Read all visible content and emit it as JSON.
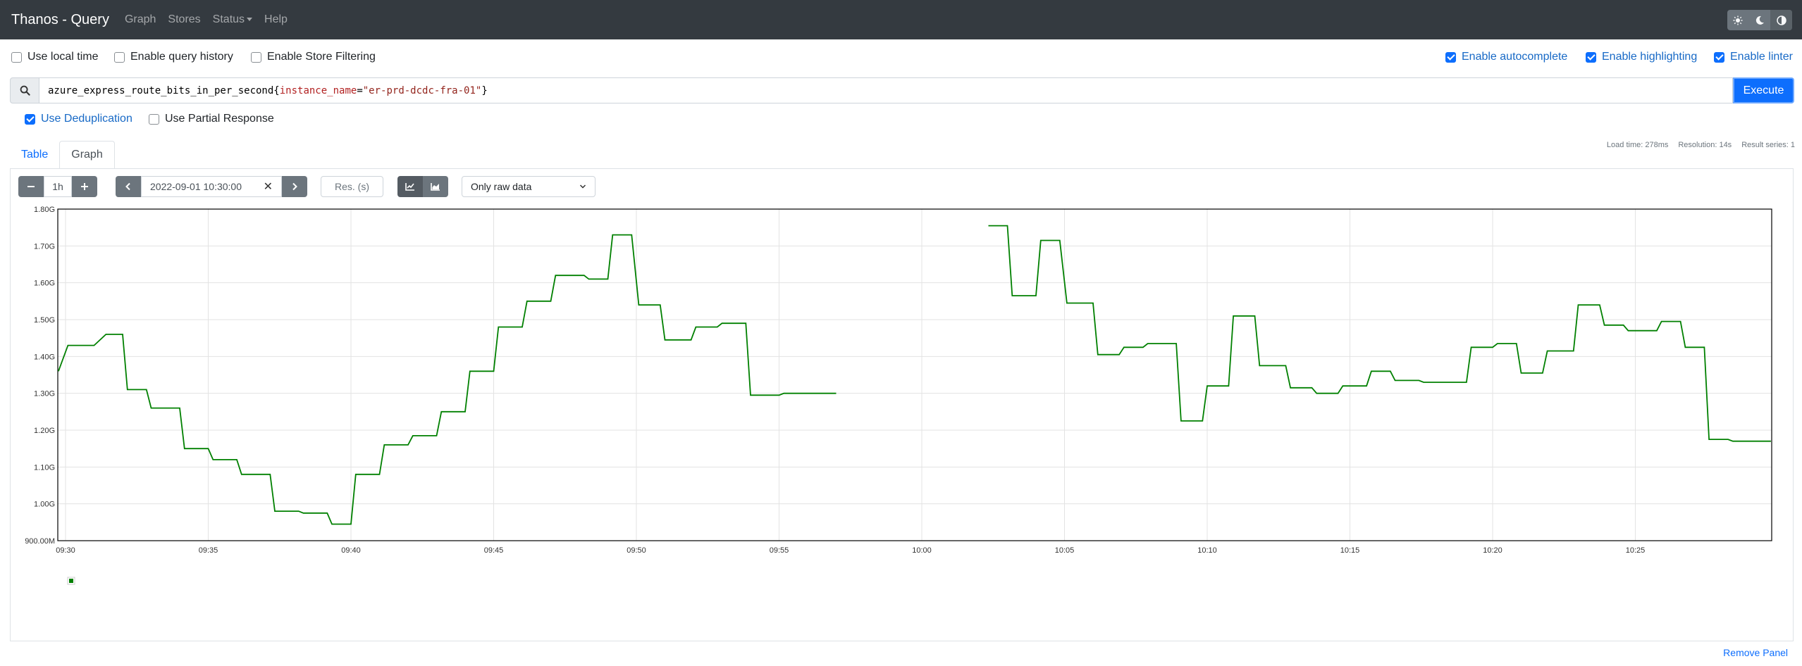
{
  "navbar": {
    "brand": "Thanos - Query",
    "links": [
      "Graph",
      "Stores",
      "Status",
      "Help"
    ],
    "theme_icons": [
      "sun-icon",
      "moon-icon",
      "contrast-icon"
    ]
  },
  "options_left": [
    {
      "label": "Use local time",
      "checked": false
    },
    {
      "label": "Enable query history",
      "checked": false
    },
    {
      "label": "Enable Store Filtering",
      "checked": false
    }
  ],
  "options_right": [
    {
      "label": "Enable autocomplete",
      "checked": true
    },
    {
      "label": "Enable highlighting",
      "checked": true
    },
    {
      "label": "Enable linter",
      "checked": true
    }
  ],
  "expression": {
    "metric": "azure_express_route_bits_in_per_second",
    "open_brace": "{",
    "label_name": "instance_name",
    "operator": "=",
    "label_value": "\"er-prd-dcdc-fra-01\"",
    "close_brace": "}"
  },
  "execute_label": "Execute",
  "query_options": [
    {
      "label": "Use Deduplication",
      "checked": true
    },
    {
      "label": "Use Partial Response",
      "checked": false
    }
  ],
  "tabs": [
    {
      "label": "Table",
      "active": false
    },
    {
      "label": "Graph",
      "active": true
    }
  ],
  "stats": {
    "load_time": "Load time: 278ms",
    "resolution": "Resolution: 14s",
    "result_series": "Result series: 1"
  },
  "graph_controls": {
    "range": "1h",
    "end_time": "2022-09-01 10:30:00",
    "res_placeholder": "Res. (s)",
    "downsampling": "Only raw data"
  },
  "colors": {
    "series": "#008000",
    "navbar": "#343a40",
    "primary": "#0d6efd"
  },
  "chart_data": {
    "type": "line",
    "x_unit": "time",
    "ylim": [
      900000000,
      1800000000
    ],
    "y_ticks": [
      "900.00M",
      "1.00G",
      "1.10G",
      "1.20G",
      "1.30G",
      "1.40G",
      "1.50G",
      "1.60G",
      "1.70G",
      "1.80G"
    ],
    "x_ticks": [
      "09:30",
      "09:35",
      "09:40",
      "09:45",
      "09:50",
      "09:55",
      "10:00",
      "10:05",
      "10:10",
      "10:15",
      "10:20",
      "10:25"
    ],
    "grid": true,
    "series": [
      {
        "segments": [
          [
            [
              "09:29:45",
              1.36
            ],
            [
              "09:30:05",
              1.43
            ],
            [
              "09:31:00",
              1.43
            ],
            [
              "09:31:25",
              1.46
            ],
            [
              "09:32:00",
              1.46
            ],
            [
              "09:32:10",
              1.31
            ],
            [
              "09:32:50",
              1.31
            ],
            [
              "09:33:00",
              1.26
            ],
            [
              "09:34:00",
              1.26
            ],
            [
              "09:34:10",
              1.15
            ],
            [
              "09:35:00",
              1.15
            ],
            [
              "09:35:10",
              1.12
            ],
            [
              "09:36:00",
              1.12
            ],
            [
              "09:36:10",
              1.08
            ],
            [
              "09:37:10",
              1.08
            ],
            [
              "09:37:20",
              0.98
            ],
            [
              "09:38:10",
              0.98
            ],
            [
              "09:38:20",
              0.975
            ],
            [
              "09:39:10",
              0.975
            ],
            [
              "09:39:20",
              0.945
            ],
            [
              "09:40:00",
              0.945
            ],
            [
              "09:40:10",
              1.08
            ],
            [
              "09:41:00",
              1.08
            ],
            [
              "09:41:10",
              1.16
            ],
            [
              "09:42:00",
              1.16
            ],
            [
              "09:42:10",
              1.185
            ],
            [
              "09:43:00",
              1.185
            ],
            [
              "09:43:10",
              1.25
            ],
            [
              "09:44:00",
              1.25
            ],
            [
              "09:44:10",
              1.36
            ],
            [
              "09:45:00",
              1.36
            ],
            [
              "09:45:10",
              1.48
            ],
            [
              "09:46:00",
              1.48
            ],
            [
              "09:46:10",
              1.55
            ],
            [
              "09:47:00",
              1.55
            ],
            [
              "09:47:10",
              1.62
            ],
            [
              "09:48:10",
              1.62
            ],
            [
              "09:48:20",
              1.61
            ],
            [
              "09:49:00",
              1.61
            ],
            [
              "09:49:10",
              1.73
            ],
            [
              "09:49:50",
              1.73
            ],
            [
              "09:50:05",
              1.54
            ],
            [
              "09:50:50",
              1.54
            ],
            [
              "09:51:00",
              1.445
            ],
            [
              "09:51:55",
              1.445
            ],
            [
              "09:52:05",
              1.48
            ],
            [
              "09:52:50",
              1.48
            ],
            [
              "09:53:00",
              1.49
            ],
            [
              "09:53:50",
              1.49
            ],
            [
              "09:54:00",
              1.295
            ],
            [
              "09:55:00",
              1.295
            ],
            [
              "09:55:10",
              1.3
            ],
            [
              "09:57:00",
              1.3
            ]
          ],
          [
            [
              "10:02:20",
              1.755
            ],
            [
              "10:03:00",
              1.755
            ],
            [
              "10:03:10",
              1.565
            ],
            [
              "10:04:00",
              1.565
            ],
            [
              "10:04:10",
              1.715
            ],
            [
              "10:04:50",
              1.715
            ],
            [
              "10:05:05",
              1.545
            ],
            [
              "10:06:00",
              1.545
            ],
            [
              "10:06:10",
              1.405
            ],
            [
              "10:06:55",
              1.405
            ],
            [
              "10:07:05",
              1.425
            ],
            [
              "10:07:45",
              1.425
            ],
            [
              "10:07:55",
              1.435
            ],
            [
              "10:08:55",
              1.435
            ],
            [
              "10:09:05",
              1.225
            ],
            [
              "10:09:50",
              1.225
            ],
            [
              "10:10:00",
              1.32
            ],
            [
              "10:10:45",
              1.32
            ],
            [
              "10:10:55",
              1.51
            ],
            [
              "10:11:40",
              1.51
            ],
            [
              "10:11:50",
              1.375
            ],
            [
              "10:12:45",
              1.375
            ],
            [
              "10:12:55",
              1.315
            ],
            [
              "10:13:40",
              1.315
            ],
            [
              "10:13:50",
              1.3
            ],
            [
              "10:14:35",
              1.3
            ],
            [
              "10:14:45",
              1.32
            ],
            [
              "10:15:35",
              1.32
            ],
            [
              "10:15:45",
              1.36
            ],
            [
              "10:16:25",
              1.36
            ],
            [
              "10:16:35",
              1.335
            ],
            [
              "10:17:25",
              1.335
            ],
            [
              "10:17:35",
              1.33
            ],
            [
              "10:19:05",
              1.33
            ],
            [
              "10:19:15",
              1.425
            ],
            [
              "10:20:00",
              1.425
            ],
            [
              "10:20:10",
              1.435
            ],
            [
              "10:20:50",
              1.435
            ],
            [
              "10:21:00",
              1.355
            ],
            [
              "10:21:45",
              1.355
            ],
            [
              "10:21:55",
              1.415
            ],
            [
              "10:22:50",
              1.415
            ],
            [
              "10:23:00",
              1.54
            ],
            [
              "10:23:45",
              1.54
            ],
            [
              "10:23:55",
              1.485
            ],
            [
              "10:24:35",
              1.485
            ],
            [
              "10:24:45",
              1.47
            ],
            [
              "10:25:45",
              1.47
            ],
            [
              "10:25:55",
              1.495
            ],
            [
              "10:26:35",
              1.495
            ],
            [
              "10:26:45",
              1.425
            ],
            [
              "10:27:25",
              1.425
            ],
            [
              "10:27:35",
              1.175
            ],
            [
              "10:28:15",
              1.175
            ],
            [
              "10:28:25",
              1.17
            ],
            [
              "10:29:45",
              1.17
            ]
          ]
        ]
      }
    ],
    "y_unit_note": "values in billions (G)"
  },
  "remove_panel": "Remove Panel"
}
